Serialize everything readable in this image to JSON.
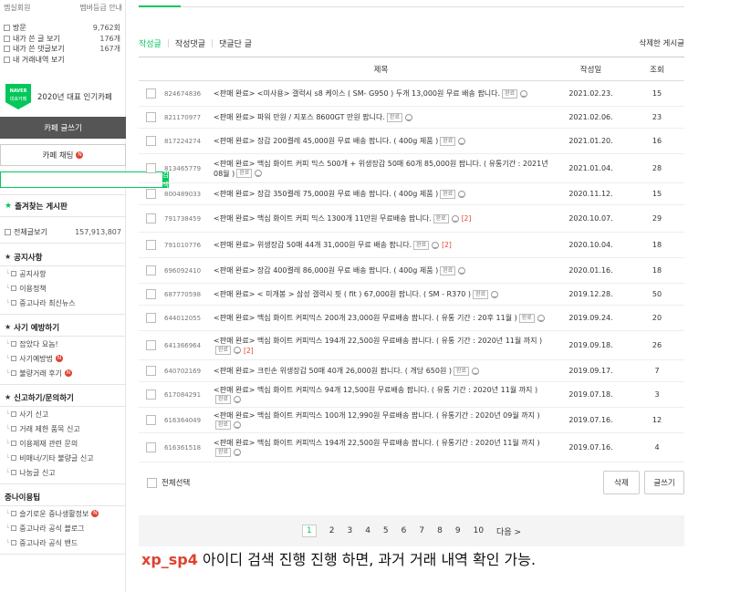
{
  "sidebar": {
    "grade_label": "멤실회원",
    "member_guide": "멤버등급 안내",
    "stats": [
      {
        "label": "방문",
        "value": "9,762회"
      },
      {
        "label": "내가 쓴 글 보기",
        "value": "176개"
      },
      {
        "label": "내가 쓴 댓글보기",
        "value": "167개"
      },
      {
        "label": "내 거래내역 보기",
        "value": ""
      }
    ],
    "naver_badge_line1": "NAVER",
    "naver_badge_line2": "대표카페",
    "popular_cafe": "2020년 대표 인기카페",
    "write_button": "카페 글쓰기",
    "chat_button": "카페 채팅",
    "search_button": "검색",
    "favorites_title": "즐겨찾는 게시판",
    "all_posts_label": "전체글보기",
    "all_posts_count": "157,913,807",
    "sections": [
      {
        "title": "공지사항",
        "items": [
          "공지사항",
          "이용정책",
          "중고나라 최신뉴스"
        ]
      },
      {
        "title": "사기 예방하기",
        "items": [
          "잡았다 요놈!",
          "사기예방법",
          "불량거래 후기"
        ]
      },
      {
        "title": "신고하기/문의하기",
        "items": [
          "사기 신고",
          "거래 제한 품목 신고",
          "이용제재 관련 문의",
          "비매너/기타 불량글 신고",
          "나눔글 신고"
        ]
      },
      {
        "title": "중나이용팁",
        "items": [
          "슬기로운 중나생활정보",
          "중고나라 공식 블로그",
          "중고나라 공식 밴드"
        ]
      }
    ]
  },
  "tabs": {
    "posts": "작성글",
    "comments": "작성댓글",
    "commented": "댓글단 글",
    "deleted": "삭제한 게시글"
  },
  "table": {
    "headers": {
      "title": "제목",
      "date": "작성일",
      "views": "조회"
    },
    "rows": [
      {
        "id": "824674836",
        "title": "<판매 완료> <미사용> 갤럭시 s8 케이스 ( SM- G950 ) 두개 13,000원 무료 배송 팝니다.",
        "date": "2021.02.23.",
        "views": "15",
        "comments": ""
      },
      {
        "id": "821170977",
        "title": "<판매 완료> 파워 만원 / 지포스 8600GT 만원 팝니다.",
        "date": "2021.02.06.",
        "views": "23",
        "comments": ""
      },
      {
        "id": "817224274",
        "title": "<판매 완료> 장갑 200켤레 45,000원 무료 배송 팝니다. ( 400g 제품 )",
        "date": "2021.01.20.",
        "views": "16",
        "comments": ""
      },
      {
        "id": "813465779",
        "title": "<판매 완료> 맥심 화이트 커피 믹스 500개 + 위생장갑 50매 60개 85,000원 팝니다. ( 유통기간 : 2021년 08월 )",
        "date": "2021.01.04.",
        "views": "28",
        "comments": ""
      },
      {
        "id": "800489033",
        "title": "<판매 완료> 장갑 350켤레 75,000원 무료 배송 팝니다. ( 400g 제품 )",
        "date": "2020.11.12.",
        "views": "15",
        "comments": ""
      },
      {
        "id": "791738459",
        "title": "<판매 완료> 맥심 화이트 커피 믹스 1300개 11만원 무료배송 팝니다.",
        "date": "2020.10.07.",
        "views": "29",
        "comments": "[2]"
      },
      {
        "id": "791010776",
        "title": "<판매 완료> 위생장갑 50매 44개 31,000원 무료 배송 팝니다.",
        "date": "2020.10.04.",
        "views": "18",
        "comments": "[2]"
      },
      {
        "id": "696092410",
        "title": "<판매 완료> 장갑 400켤레 86,000원 무료 배송 팝니다. ( 400g 제품 )",
        "date": "2020.01.16.",
        "views": "18",
        "comments": ""
      },
      {
        "id": "687770598",
        "title": "<판매 완료> < 미개봉 > 삼성 갤럭시 핏 ( fit ) 67,000원 팝니다. ( SM - R370 )",
        "date": "2019.12.28.",
        "views": "50",
        "comments": ""
      },
      {
        "id": "644012055",
        "title": "<판매 완료> 맥심 화이트 커피믹스 200개 23,000원 무료배송 팝니다. ( 유통 기간 : 20후 11월 )",
        "date": "2019.09.24.",
        "views": "20",
        "comments": ""
      },
      {
        "id": "641366964",
        "title": "<판매 완료> 맥심 화이트 커피믹스 194개 22,500원 무료배송 팝니다. ( 유통 기간 : 2020년 11월 까지 )",
        "date": "2019.09.18.",
        "views": "26",
        "comments": "[2]"
      },
      {
        "id": "640702169",
        "title": "<판매 완료> 크린손 위생장갑 50매 40개 26,000원 팝니다. ( 개당 650원 )",
        "date": "2019.09.17.",
        "views": "7",
        "comments": ""
      },
      {
        "id": "617084291",
        "title": "<판매 완료> 맥심 화이트 커피믹스 94개 12,500원 무료배송 팝니다. ( 유통 기간 : 2020년 11월 까지 )",
        "date": "2019.07.18.",
        "views": "3",
        "comments": ""
      },
      {
        "id": "616364049",
        "title": "<판매 완료> 맥심 화이트 커피믹스 100개 12,990원 무료배송 팝니다. ( 유통기간 : 2020년 09월 까지 )",
        "date": "2019.07.16.",
        "views": "12",
        "comments": ""
      },
      {
        "id": "616361518",
        "title": "<판매 완료> 맥심 화이트 커피믹스 194개 22,500원 무료배송 팝니다. ( 유통기간 : 2020년 11월 까지 )",
        "date": "2019.07.16.",
        "views": "4",
        "comments": ""
      }
    ],
    "done_tag": "완료"
  },
  "footer": {
    "select_all": "전체선택",
    "delete_button": "삭제",
    "write_button": "글쓰기"
  },
  "pagination": {
    "pages": [
      "1",
      "2",
      "3",
      "4",
      "5",
      "6",
      "7",
      "8",
      "9",
      "10"
    ],
    "next": "다음 >"
  },
  "caption": {
    "id": "xp_sp4",
    "text": " 아이디 검색 진행 진행 하면, 과거 거래 내역 확인 가능."
  },
  "colors": {
    "naver_green": "#03c75a",
    "caption_red": "#e0412f",
    "dark_button": "#555555"
  }
}
